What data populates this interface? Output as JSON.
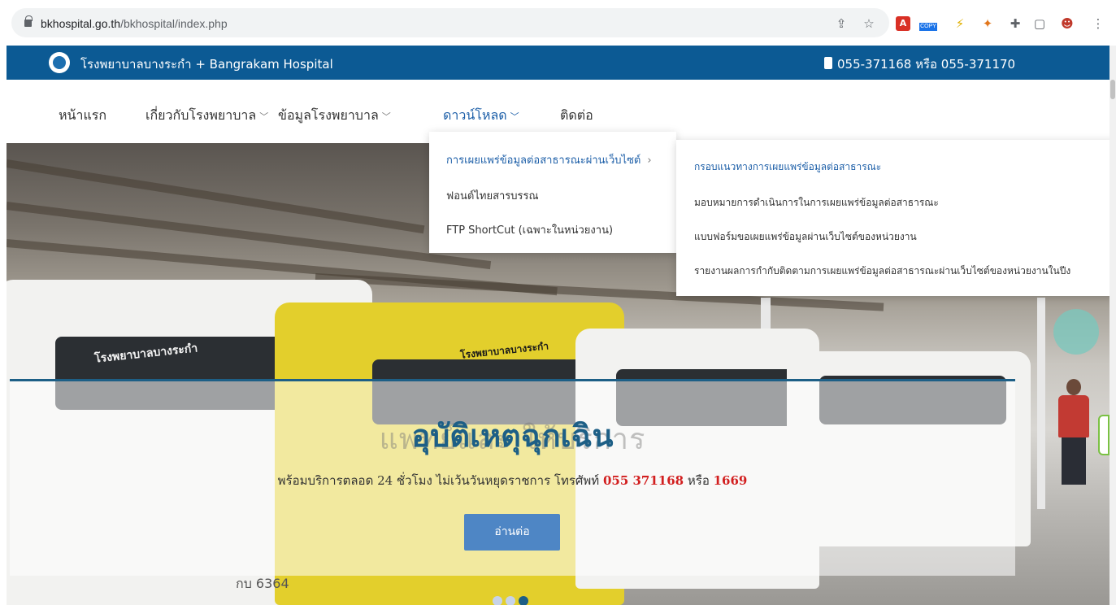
{
  "browser": {
    "url_domain": "bkhospital.go.th",
    "url_path": "/bkhospital/index.php",
    "copy_badge": "COPY"
  },
  "header": {
    "site_name": "โรงพยาบาลบางระกำ + Bangrakam Hospital",
    "phone": "055-371168 หรือ 055-371170",
    "brand_color": "#0c5a94"
  },
  "nav": {
    "items": [
      {
        "label": "หน้าแรก"
      },
      {
        "label": "เกี่ยวกับโรงพยาบาล"
      },
      {
        "label": "ข้อมูลโรงพยาบาล"
      },
      {
        "label": "ดาวน์โหลด"
      },
      {
        "label": "ติดต่อ"
      }
    ]
  },
  "download_menu": {
    "items": [
      {
        "label": "การเผยแพร่ข้อมูลต่อสาธารณะผ่านเว็บไซต์"
      },
      {
        "label": "ฟอนต์ไทยสารบรรณ"
      },
      {
        "label": "FTP ShortCut (เฉพาะในหน่วยงาน)"
      }
    ]
  },
  "submenu": {
    "items": [
      {
        "label": "กรอบแนวทางการเผยแพร่ข้อมูลต่อสาธารณะ"
      },
      {
        "label": "มอบหมายการดำเนินการในการเผยแพร่ข้อมูลต่อสาธารณะ"
      },
      {
        "label": "แบบฟอร์มขอเผยแพร่ข้อมูลผ่านเว็บไซต์ของหน่วยงาน"
      },
      {
        "label": "รายงานผลการกำกับติดตามการเผยแพร่ข้อมูลต่อสาธารณะผ่านเว็บไซต์ของหน่วยงานในปีง"
      }
    ]
  },
  "slide": {
    "faded_text": "แพทย์และ                            ให้บริการ",
    "title": "อุบัติเหตุฉุกเฉิน",
    "subtitle_prefix": "พร้อมบริการตลอด 24 ชั่วโมง ไม่เว้นวันหยุดราชการ โทรศัพท์ ",
    "phone1": "055 371168",
    "middle": " หรือ ",
    "phone2": "1669",
    "button": "อ่านต่อ",
    "van_label": "โรงพยาบาลบางระกำ",
    "plate": "กบ 6364"
  }
}
